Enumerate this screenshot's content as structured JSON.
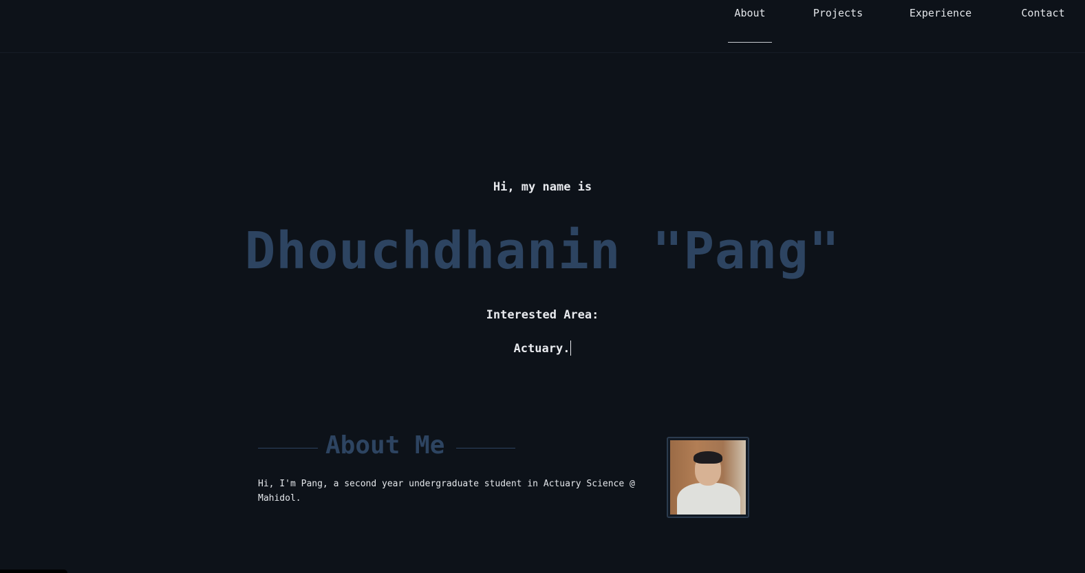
{
  "nav": {
    "items": [
      {
        "label": "About",
        "active": true
      },
      {
        "label": "Projects",
        "active": false
      },
      {
        "label": "Experience",
        "active": false
      },
      {
        "label": "Contact",
        "active": false
      }
    ]
  },
  "hero": {
    "greeting": "Hi, my name is",
    "name": "Dhouchdhanin \"Pang\"",
    "interest_label": "Interested Area:",
    "interest_value": "Actuary."
  },
  "about": {
    "title": "About Me",
    "description": "Hi, I'm Pang, a second year undergraduate student in Actuary Science @ Mahidol."
  },
  "colors": {
    "background": "#0d1219",
    "accent": "#2d4461",
    "text": "#e8eaee"
  }
}
